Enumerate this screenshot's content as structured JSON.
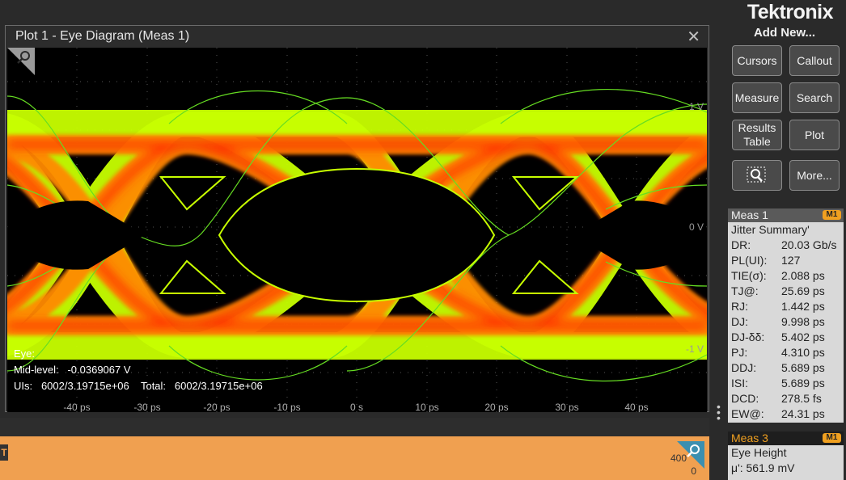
{
  "brand": "Tektronix",
  "plot": {
    "title": "Plot 1 - Eye Diagram (Meas 1)",
    "y_labels": {
      "top": "1 V",
      "mid": "0 V",
      "bottom": "-1 V"
    },
    "x_labels": [
      "-40 ps",
      "-30 ps",
      "-20 ps",
      "-10 ps",
      "0 s",
      "10 ps",
      "20 ps",
      "30 ps",
      "40 ps"
    ],
    "info": {
      "line1": "Eye:",
      "line2": "Mid-level:   -0.0369067 V",
      "line3": "UIs:   6002/3.19715e+06    Total:   6002/3.19715e+06"
    },
    "colors": {
      "hot": "#ff2a00",
      "warm": "#ff8a00",
      "cool": "#c8ff00",
      "edge": "#66dd22"
    }
  },
  "sidebar": {
    "add_new": "Add New...",
    "buttons": {
      "cursors": "Cursors",
      "callout": "Callout",
      "measure": "Measure",
      "search": "Search",
      "results_table": "Results Table",
      "plot": "Plot",
      "more": "More..."
    }
  },
  "meas1": {
    "title": "Meas 1",
    "badge": "M1",
    "subtitle": "Jitter Summary'",
    "rows": [
      {
        "k": "DR:",
        "v": "20.03 Gb/s"
      },
      {
        "k": "PL(UI):",
        "v": "127"
      },
      {
        "k": "TIE(σ):",
        "v": "2.088 ps"
      },
      {
        "k": "TJ@:",
        "v": "25.69 ps"
      },
      {
        "k": "RJ:",
        "v": "1.442 ps"
      },
      {
        "k": "DJ:",
        "v": "9.998 ps"
      },
      {
        "k": "DJ-δδ:",
        "v": "5.402 ps"
      },
      {
        "k": "PJ:",
        "v": "4.310 ps"
      },
      {
        "k": "DDJ:",
        "v": "5.689 ps"
      },
      {
        "k": "ISI:",
        "v": "5.689 ps"
      },
      {
        "k": "DCD:",
        "v": "278.5 fs"
      },
      {
        "k": "EW@:",
        "v": "24.31 ps"
      }
    ]
  },
  "meas3": {
    "title": "Meas 3",
    "badge": "M1",
    "subtitle": "Eye Height",
    "value": "μ': 561.9 mV"
  },
  "bottom": {
    "scale_label": "400",
    "zero_label": "0",
    "marker": "T"
  }
}
